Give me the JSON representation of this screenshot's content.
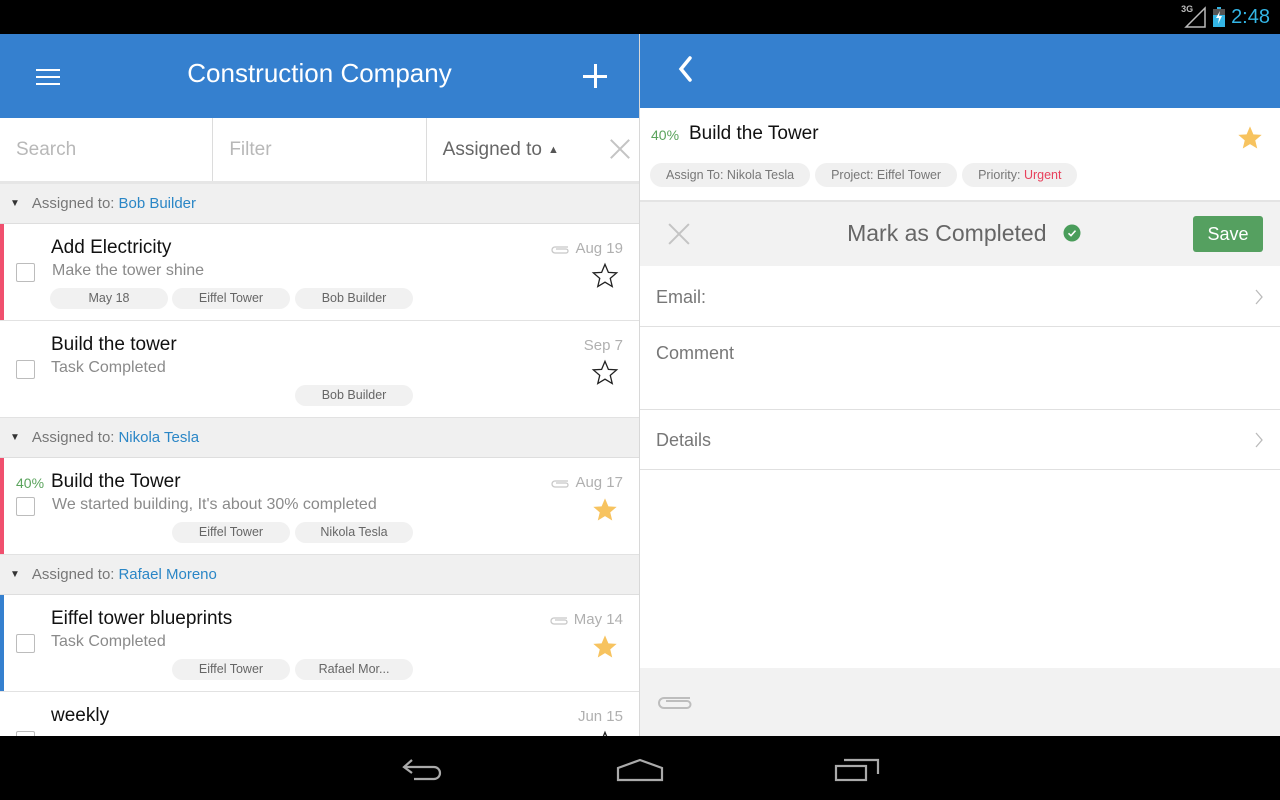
{
  "status_bar": {
    "network": "3G",
    "time": "2:48"
  },
  "left_pane": {
    "app_title": "Construction Company",
    "filters": {
      "search_placeholder": "Search",
      "filter_placeholder": "Filter",
      "sort_label": "Assigned to",
      "sort_direction_icon": "triangle-up-icon"
    },
    "groups": [
      {
        "prefix": "Assigned to:",
        "assignee": "Bob Builder",
        "tasks": [
          {
            "title": "Add Electricity",
            "subtitle": "Make the tower shine",
            "date": "Aug 19",
            "has_attachment": true,
            "starred": false,
            "progress": "",
            "stripe": "#f0506e",
            "tags": [
              "May 18",
              "Eiffel Tower",
              "Bob Builder"
            ]
          },
          {
            "title": "Build the tower",
            "subtitle": "Task Completed",
            "date": "Sep 7",
            "has_attachment": false,
            "starred": false,
            "progress": "",
            "stripe": "",
            "tags": [
              "",
              "",
              "Bob Builder"
            ]
          }
        ]
      },
      {
        "prefix": "Assigned to:",
        "assignee": "Nikola Tesla",
        "tasks": [
          {
            "title": "Build the Tower",
            "subtitle": "We started building, It's about 30% completed",
            "date": "Aug 17",
            "has_attachment": true,
            "starred": true,
            "progress": "40%",
            "stripe": "#f0506e",
            "tags": [
              "",
              "Eiffel Tower",
              "Nikola Tesla"
            ]
          }
        ]
      },
      {
        "prefix": "Assigned to:",
        "assignee": "Rafael Moreno",
        "tasks": [
          {
            "title": "Eiffel tower blueprints",
            "subtitle": "Task Completed",
            "date": "May 14",
            "has_attachment": true,
            "starred": true,
            "progress": "",
            "stripe": "#3580cf",
            "tags": [
              "",
              "Eiffel Tower",
              "Rafael Mor..."
            ]
          },
          {
            "title": "weekly",
            "subtitle": "",
            "date": "Jun 15",
            "has_attachment": false,
            "starred": false,
            "progress": "",
            "stripe": "",
            "tags": [
              "",
              "",
              ""
            ]
          }
        ]
      }
    ]
  },
  "detail": {
    "progress": "40%",
    "title": "Build the Tower",
    "starred": true,
    "chips": {
      "assign": "Assign To: Nikola Tesla",
      "project": "Project: Eiffel Tower",
      "priority_label": "Priority:",
      "priority_value": "Urgent"
    },
    "complete_bar": {
      "label": "Mark as Completed",
      "save_label": "Save"
    },
    "fields": {
      "email_label": "Email:",
      "comment_placeholder": "Comment",
      "details_label": "Details"
    }
  },
  "colors": {
    "primary": "#3580cf",
    "star": "#f7c35f",
    "progress": "#5aa35c",
    "urgent": "#e8415c",
    "save": "#55a060",
    "link": "#2a86c6"
  }
}
